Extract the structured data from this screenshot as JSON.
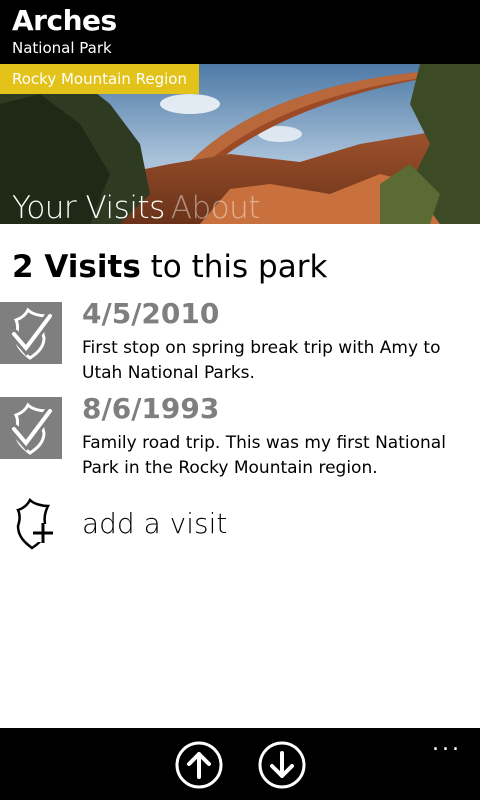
{
  "header": {
    "title": "Arches",
    "subtitle": "National Park"
  },
  "hero": {
    "region": "Rocky Mountain Region",
    "region_color": "#e3c21a"
  },
  "pivot": {
    "tabs": [
      {
        "label": "Your Visits",
        "active": true
      },
      {
        "label": "About",
        "active": false
      }
    ]
  },
  "visits": {
    "count": "2 Visits",
    "suffix": " to this park",
    "items": [
      {
        "date": "4/5/2010",
        "note": "First stop on spring break trip with Amy to Utah National Parks.",
        "icon": "checked-shield-icon"
      },
      {
        "date": "8/6/1993",
        "note": "Family road trip.  This was my first National Park in the Rocky Mountain region.",
        "icon": "checked-shield-icon"
      }
    ],
    "add_label": "add a visit"
  },
  "appbar": {
    "buttons": [
      {
        "icon": "arrow-up-icon"
      },
      {
        "icon": "arrow-down-icon"
      }
    ],
    "more": "..."
  },
  "colors": {
    "accent": "#e3c21a",
    "date_gray": "#7f7f7f",
    "bar": "#000000"
  }
}
